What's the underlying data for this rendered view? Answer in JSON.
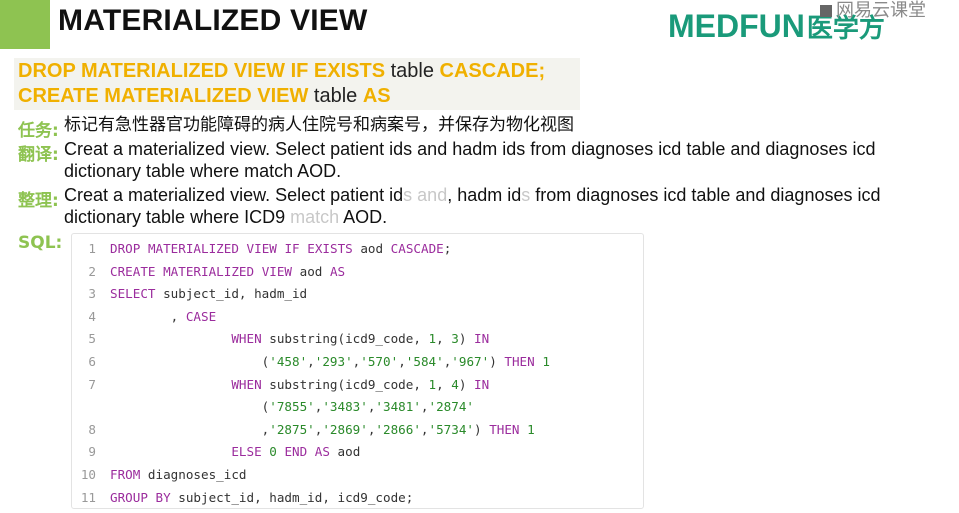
{
  "slide": {
    "title": "MATERIALIZED VIEW",
    "logo_text": "MEDFUN",
    "logo_cn": "医学方",
    "watermark": "网易云课堂"
  },
  "highlight": {
    "line1_kw": "DROP MATERIALIZED VIEW IF EXISTS",
    "line1_plain": " table ",
    "line1_kw2": "CASCADE;",
    "line2_kw": "CREATE MATERIALIZED VIEW",
    "line2_plain": " table ",
    "line2_kw2": "AS"
  },
  "task": {
    "label": "任务:",
    "text": "标记有急性器官功能障碍的病人住院号和病案号，并保存为物化视图"
  },
  "translation": {
    "label": "翻译:",
    "line1": "Creat a materialized view. Select patient ids and hadm ids from diagnoses icd table and diagnoses icd",
    "line2": "dictionary table where match AOD."
  },
  "arrangement": {
    "label": "整理:",
    "p1": "Creat a materialized view. Select patient id",
    "f1": "s and",
    "p2": ", hadm id",
    "f2": "s",
    "p3": " from diagnoses icd table and diagnoses icd",
    "p4": "dictionary table where ICD9 ",
    "f3": " match",
    "p5": " AOD."
  },
  "sql": {
    "label": "SQL:",
    "lines": [
      {
        "n": "1",
        "t": "DROP MATERIALIZED VIEW IF EXISTS aod CASCADE;"
      },
      {
        "n": "2",
        "t": "CREATE MATERIALIZED VIEW aod AS"
      },
      {
        "n": "3",
        "t": "SELECT subject_id, hadm_id"
      },
      {
        "n": "4",
        "t": "        , CASE"
      },
      {
        "n": "5",
        "t": "                WHEN substring(icd9_code, 1, 3) IN"
      },
      {
        "n": "6",
        "t": "                    ('458','293','570','584','967') THEN 1"
      },
      {
        "n": "7",
        "t": "                WHEN substring(icd9_code, 1, 4) IN"
      },
      {
        "n": "",
        "t": "                    ('7855','3483','3481','2874'"
      },
      {
        "n": "8",
        "t": "                    ,'2875','2869','2866','5734') THEN 1"
      },
      {
        "n": "9",
        "t": "                ELSE 0 END AS aod"
      },
      {
        "n": "10",
        "t": "FROM diagnoses_icd"
      },
      {
        "n": "11",
        "t": "GROUP BY subject_id, hadm_id, icd9_code;"
      }
    ]
  }
}
